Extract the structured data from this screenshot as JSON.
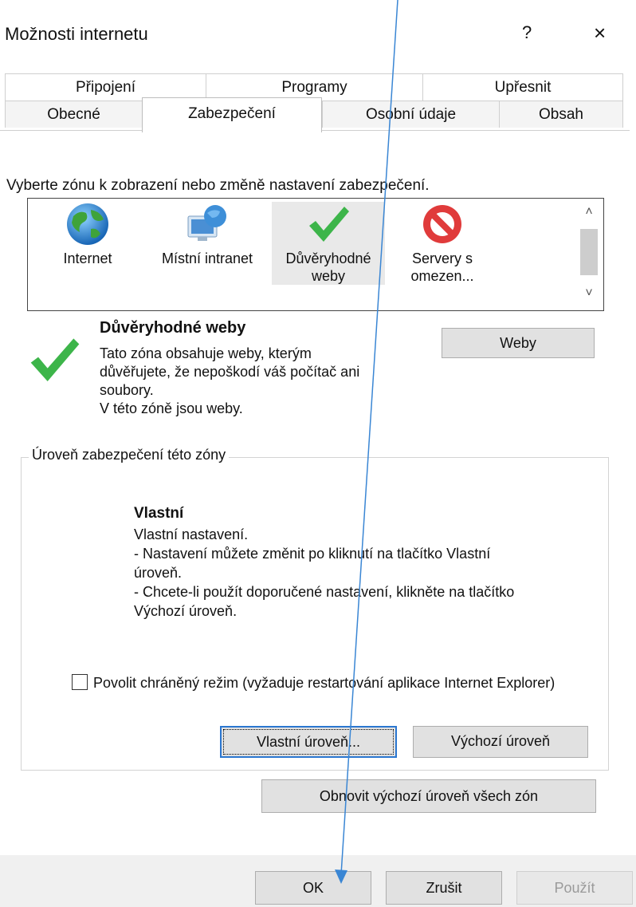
{
  "window": {
    "title": "Možnosti internetu",
    "help": "?",
    "close": "×"
  },
  "tabs": {
    "row1": [
      "Připojení",
      "Programy",
      "Upřesnit"
    ],
    "row2": [
      "Obecné",
      "Zabezpečení",
      "Osobní údaje",
      "Obsah"
    ],
    "active": "Zabezpečení"
  },
  "zones": {
    "prompt": "Vyberte zónu k zobrazení nebo změně nastavení zabezpečení.",
    "items": [
      {
        "label": "Internet",
        "icon": "globe-icon"
      },
      {
        "label": "Místní intranet",
        "icon": "network-globe-icon"
      },
      {
        "label": "Důvěryhodné weby",
        "icon": "checkmark-icon"
      },
      {
        "label": "Servery s omezen...",
        "icon": "prohibited-icon"
      }
    ],
    "selected": "Důvěryhodné weby"
  },
  "zone_info": {
    "name": "Důvěryhodné weby",
    "description": [
      "Tato zóna obsahuje weby, kterým",
      "důvěřujete, že nepoškodí váš počítač ani",
      "soubory.",
      "V této zóně jsou weby."
    ],
    "sites_button": "Weby"
  },
  "security_level": {
    "group_label": "Úroveň zabezpečení této zóny",
    "title": "Vlastní",
    "lines": [
      "Vlastní nastavení.",
      "- Nastavení můžete změnit po kliknutí na tlačítko Vlastní",
      "úroveň.",
      "- Chcete-li použít doporučené nastavení, klikněte na tlačítko",
      "Výchozí úroveň."
    ],
    "protected_mode_label": "Povolit chráněný režim (vyžaduje restartování aplikace Internet Explorer)",
    "protected_mode_checked": false,
    "custom_button": "Vlastní úroveň...",
    "default_button": "Výchozí úroveň",
    "reset_all_button": "Obnovit výchozí úroveň všech zón"
  },
  "footer": {
    "ok": "OK",
    "cancel": "Zrušit",
    "apply": "Použít"
  },
  "colors": {
    "accent_arrow": "#3a86d4",
    "check_green": "#3db54a",
    "prohibited_red": "#d42a2a"
  }
}
